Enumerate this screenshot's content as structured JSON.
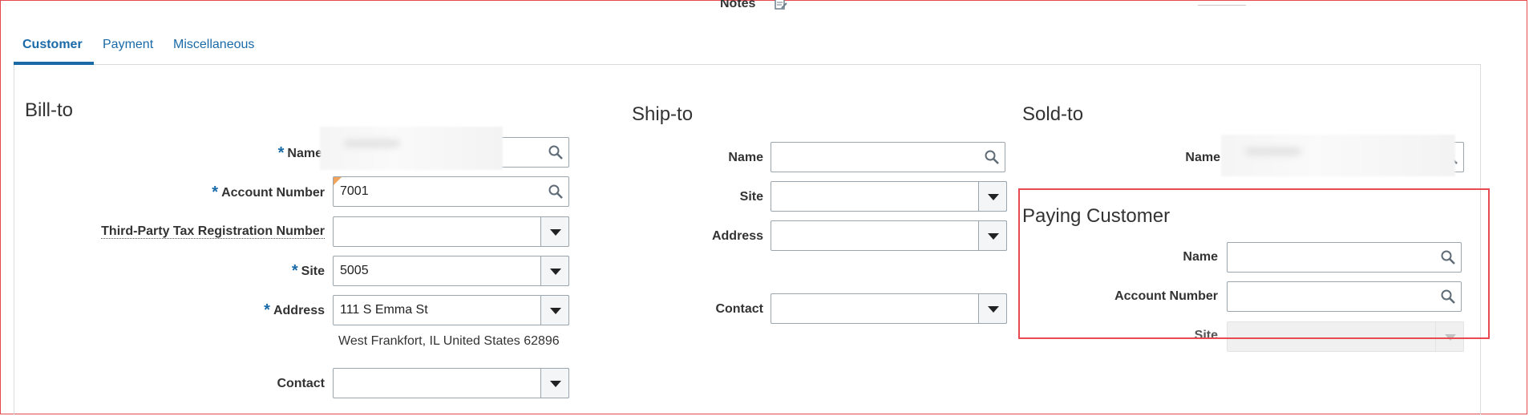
{
  "header": {
    "notes_label": "Notes"
  },
  "tabs": [
    {
      "label": "Customer",
      "active": true
    },
    {
      "label": "Payment",
      "active": false
    },
    {
      "label": "Miscellaneous",
      "active": false
    }
  ],
  "bill_to": {
    "title": "Bill-to",
    "name_label": "Name",
    "name_value": "",
    "account_label": "Account Number",
    "account_value": "7001",
    "tax_label": "Third-Party Tax Registration Number",
    "tax_value": "",
    "site_label": "Site",
    "site_value": "5005",
    "address_label": "Address",
    "address_value": "111 S Emma St",
    "address_line": "West Frankfort, IL United States 62896",
    "contact_label": "Contact",
    "contact_value": ""
  },
  "ship_to": {
    "title": "Ship-to",
    "name_label": "Name",
    "site_label": "Site",
    "address_label": "Address",
    "contact_label": "Contact"
  },
  "sold_to": {
    "title": "Sold-to",
    "name_label": "Name"
  },
  "paying_customer": {
    "title": "Paying Customer",
    "name_label": "Name",
    "account_label": "Account Number",
    "site_label": "Site"
  },
  "colors": {
    "accent": "#1a6aa8",
    "highlight": "#e84a52",
    "required_warning": "#f0a35c"
  }
}
